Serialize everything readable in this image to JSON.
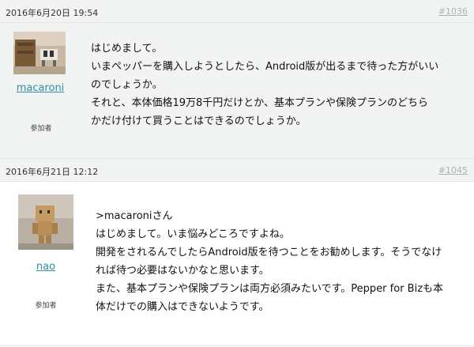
{
  "posts": [
    {
      "date": "2016年6月20日 19:54",
      "permalink": "#1036",
      "author": "macaroni",
      "role": "参加者",
      "lines": [
        "はじめまして。",
        "いまペッパーを購入しようとしたら、Android版が出るまで待った方がいい",
        "のでしょうか。",
        "それと、本体価格19万8千円だけとか、基本プランや保険プランのどちら",
        "かだけ付けて買うことはできるのでしょうか。"
      ]
    },
    {
      "date": "2016年6月21日 12:12",
      "permalink": "#1045",
      "author": "nao",
      "role": "参加者",
      "lines": [
        ">macaroniさん",
        "はじめまして。いま悩みどころですよね。",
        "開発をされるんでしたらAndroid版を待つことをお勧めします。そうでなけ",
        "れば待つ必要はないかなと思います。",
        "また、基本プランや保険プランは両方必須みたいです。Pepper for Bizも本",
        "体だけでの購入はできないようです。"
      ]
    }
  ]
}
